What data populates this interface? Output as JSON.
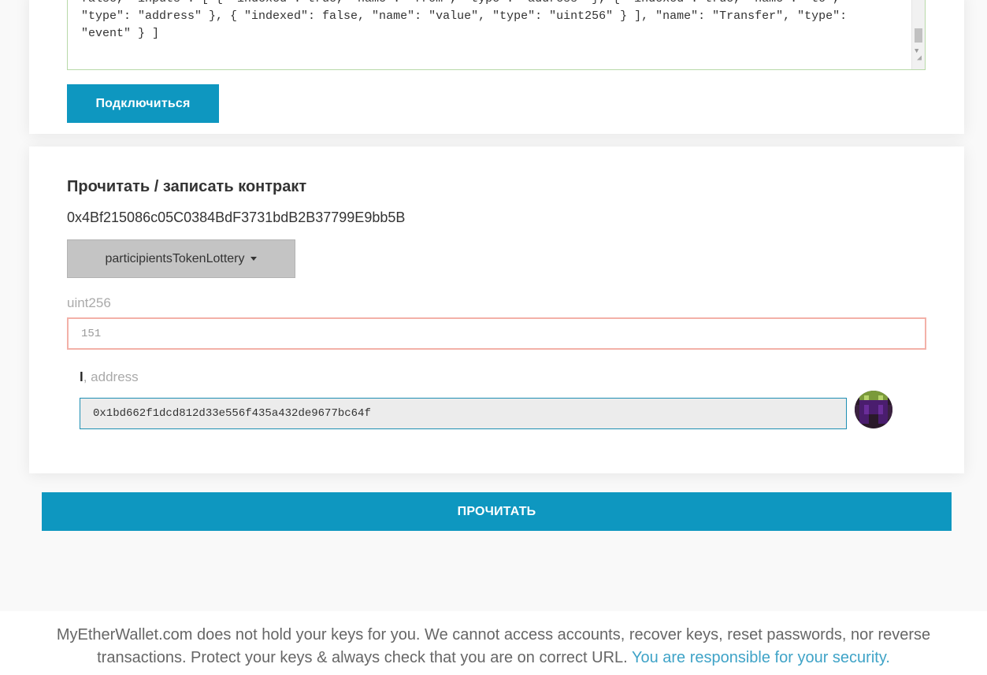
{
  "abi": {
    "line1": "false, \"inputs\": [ { \"indexed\": true, \"name\": \"from\", \"type\": \"address\" }, { \"indexed\": true, \"name\": \"to\",",
    "line2": "\"type\": \"address\" }, { \"indexed\": false, \"name\": \"value\", \"type\": \"uint256\" } ], \"name\": \"Transfer\", \"type\":",
    "line3": "\"event\" } ]"
  },
  "connect_button": "Подключиться",
  "read_write": {
    "title": "Прочитать / записать контракт",
    "contract_address": "0x4Bf215086c05C0384BdF3731bdB2B37799E9bb5B",
    "function_select": "participientsTokenLottery",
    "input": {
      "label": "uint256",
      "placeholder": "151"
    },
    "output": {
      "name": "l",
      "type": ", address",
      "value": "0x1bd662f1dcd812d33e556f435a432de9677bc64f"
    }
  },
  "read_button": "ПРОЧИТАТЬ",
  "footer": {
    "text": "MyEtherWallet.com does not hold your keys for you. We cannot access accounts, recover keys, reset passwords, nor reverse transactions. Protect your keys & always check that you are on correct URL.",
    "link": "You are responsible for your security."
  },
  "colors": {
    "primary": "#0e97c0",
    "link": "#3fa3c7",
    "error_border": "#f3b1a8"
  }
}
